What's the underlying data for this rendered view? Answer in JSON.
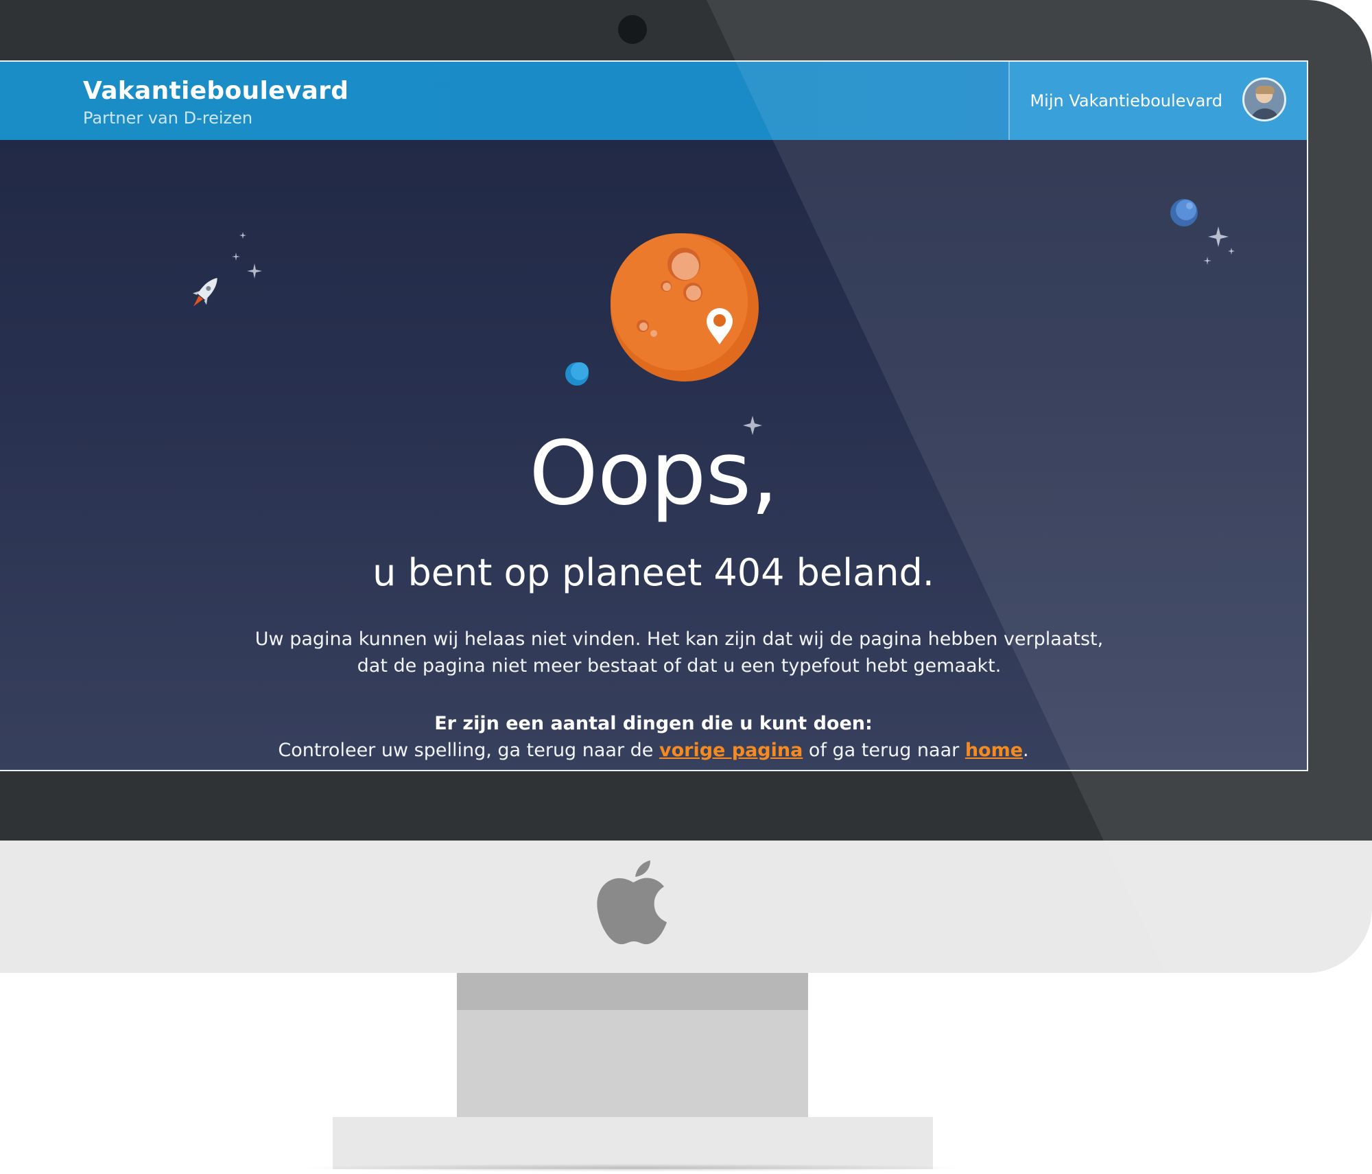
{
  "header": {
    "brand_title": "Vakantieboulevard",
    "brand_subtitle": "Partner van D-reizen",
    "account_link": "Mijn Vakantieboulevard"
  },
  "error_page": {
    "headline": "Oops,",
    "subtitle": "u bent op planeet 404 beland.",
    "description": "Uw pagina kunnen wij helaas niet vinden. Het kan zijn dat wij de pagina hebben verplaatst, dat de pagina niet meer bestaat of dat u een typefout hebt gemaakt.",
    "options_title": "Er zijn een aantal dingen die u kunt doen:",
    "options_text_1": "Controleer uw spelling, ga terug naar de ",
    "previous_page_link": "vorige pagina",
    "options_text_2": " of ga terug naar ",
    "home_link": "home",
    "options_text_3": "."
  },
  "icons": {
    "planet": "orange-planet-icon",
    "location_pin": "location-pin-icon",
    "rocket": "rocket-icon",
    "stars": "sparkle-star-icon",
    "logo": "apple-logo-icon"
  },
  "colors": {
    "header_blue": "#1a8cc6",
    "background_top": "#1f2744",
    "background_bottom": "#37405d",
    "planet_orange": "#e8762a",
    "link_orange": "#f58a20",
    "bezel": "#2f3336",
    "chin": "#e9e9e9"
  }
}
